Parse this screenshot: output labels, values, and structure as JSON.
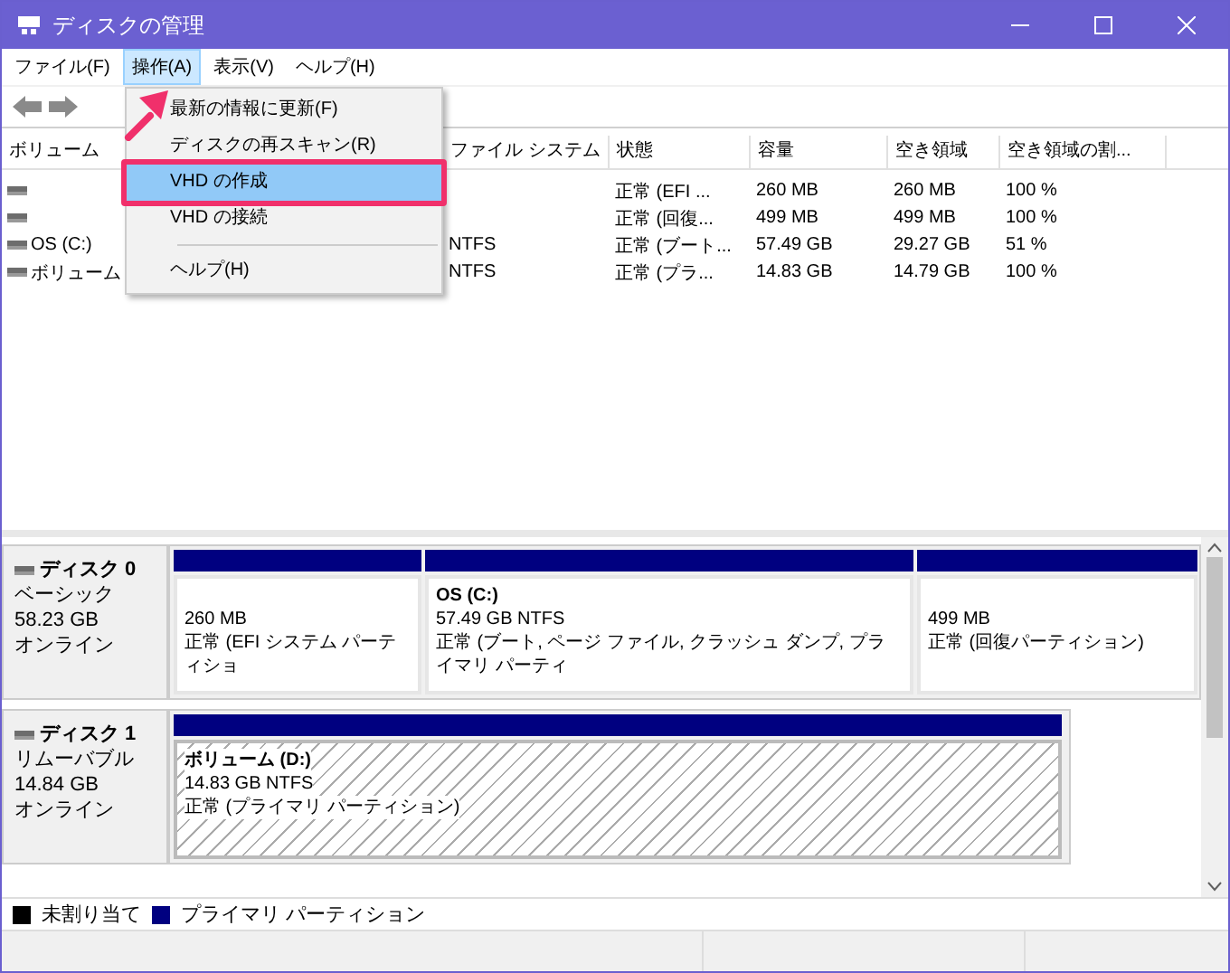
{
  "window": {
    "title": "ディスクの管理"
  },
  "menu_bar": [
    {
      "label": "ファイル(F)",
      "selected": false
    },
    {
      "label": "操作(A)",
      "selected": true
    },
    {
      "label": "表示(V)",
      "selected": false
    },
    {
      "label": "ヘルプ(H)",
      "selected": false
    }
  ],
  "dropdown": [
    {
      "kind": "item",
      "label": "最新の情報に更新(F)",
      "selected": false
    },
    {
      "kind": "item",
      "label": "ディスクの再スキャン(R)",
      "selected": false
    },
    {
      "kind": "item",
      "label": "VHD の作成",
      "selected": true
    },
    {
      "kind": "item",
      "label": "VHD の接続",
      "selected": false
    },
    {
      "kind": "separator"
    },
    {
      "kind": "item",
      "label": "ヘルプ(H)",
      "selected": false
    }
  ],
  "table": {
    "columns": [
      "ボリューム",
      "ファイル システム",
      "状態",
      "容量",
      "空き領域",
      "空き領域の割..."
    ],
    "rows": [
      {
        "volume": "",
        "filesystem": "",
        "status": "正常 (EFI ...",
        "capacity": "260 MB",
        "free": "260 MB",
        "percent": "100 %"
      },
      {
        "volume": "",
        "filesystem": "",
        "status": "正常 (回復...",
        "capacity": "499 MB",
        "free": "499 MB",
        "percent": "100 %"
      },
      {
        "volume": "OS (C:)",
        "filesystem": "NTFS",
        "status": "正常 (ブート...",
        "capacity": "57.49 GB",
        "free": "29.27 GB",
        "percent": "51 %"
      },
      {
        "volume": "ボリューム",
        "filesystem": "NTFS",
        "status": "正常 (プラ...",
        "capacity": "14.83 GB",
        "free": "14.79 GB",
        "percent": "100 %"
      }
    ]
  },
  "disks": [
    {
      "name": "ディスク 0",
      "type": "ベーシック",
      "size": "58.23 GB",
      "state": "オンライン",
      "partitions": [
        {
          "size": "260 MB",
          "status": "正常 (EFI システム パーティショ",
          "selected": false,
          "color": "#000080"
        },
        {
          "title": "OS  (C:)",
          "size": "57.49 GB NTFS",
          "status": "正常 (ブート, ページ ファイル, クラッシュ ダンプ, プライマリ パーティ",
          "selected": false,
          "color": "#000080"
        },
        {
          "size": "499 MB",
          "status": "正常 (回復パーティション)",
          "selected": false,
          "color": "#000080"
        }
      ]
    },
    {
      "name": "ディスク 1",
      "type": "リムーバブル",
      "size": "14.84 GB",
      "state": "オンライン",
      "partitions": [
        {
          "title": "ボリューム  (D:)",
          "size": "14.83 GB NTFS",
          "status": "正常 (プライマリ パーティション)",
          "selected": true,
          "color": "#000080"
        }
      ]
    }
  ],
  "legend": [
    {
      "label": "未割り当て",
      "color": "#000000"
    },
    {
      "label": "プライマリ パーティション",
      "color": "#000080"
    }
  ]
}
